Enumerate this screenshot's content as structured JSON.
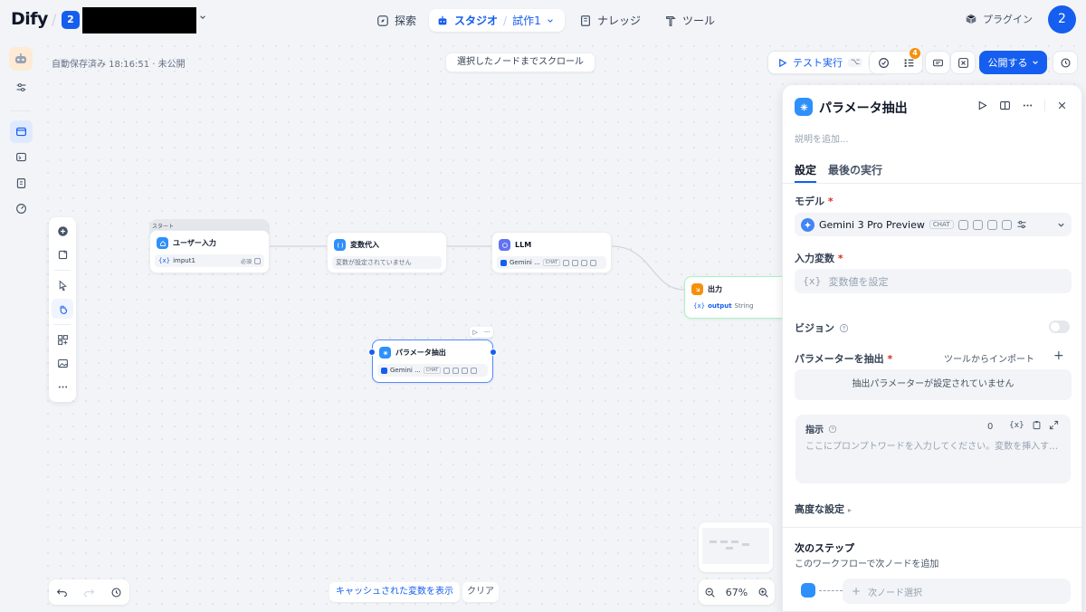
{
  "topbar": {
    "logo": "Dify",
    "workspace_badge": "2",
    "workspace_name": "",
    "nav": {
      "explore": "探索",
      "studio": "スタジオ",
      "studio_app": "試作1",
      "knowledge": "ナレッジ",
      "tools": "ツール"
    },
    "plugin": "プラグイン",
    "avatar": "2"
  },
  "canvas": {
    "autosave": "自動保存済み 18:16:51 · 未公開",
    "scroll_to_node": "選択したノードまでスクロール",
    "test_run": "テスト実行",
    "test_run_keys": [
      "⌥",
      "R"
    ],
    "checklist_badge": "4",
    "publish": "公開する",
    "zoom": "67%",
    "show_cache": "キャッシュされた変数を表示",
    "clear": "クリア"
  },
  "nodes": {
    "start_label": "スタート",
    "user_input": {
      "title": "ユーザー入力",
      "var_icon": "{x}",
      "var": "imput1",
      "required": "必須"
    },
    "assign": {
      "title": "変数代入",
      "empty": "変数が設定されていません"
    },
    "llm": {
      "title": "LLM",
      "model": "Gemini ...",
      "chip": "CHAT"
    },
    "output": {
      "title": "出力",
      "var_icon": "{x}",
      "var": "output",
      "type": "String"
    },
    "param": {
      "title": "パラメータ抽出",
      "model": "Gemini ...",
      "chip": "CHAT"
    }
  },
  "panel": {
    "title": "パラメータ抽出",
    "description_placeholder": "説明を追加...",
    "tabs": [
      "設定",
      "最後の実行"
    ],
    "model_label": "モデル",
    "model_name": "Gemini 3 Pro Preview",
    "model_chip": "CHAT",
    "input_label": "入力変数",
    "input_placeholder": "変数値を設定",
    "input_icon": "{x}",
    "vision_label": "ビジョン",
    "extract_label": "パラメーターを抽出",
    "import_tools": "ツールからインポート",
    "add": "+",
    "extract_empty": "抽出パラメーターが設定されていません",
    "instruction_label": "指示",
    "instruction_count": "0",
    "instruction_var": "{x}",
    "instruction_placeholder": "ここにプロンプトワードを入力してください。変数を挿入するには「{」を入力します。",
    "advanced": "高度な設定",
    "next_step_title": "次のステップ",
    "next_step_desc": "このワークフローで次ノードを追加",
    "next_node_select": "次ノード選択",
    "required_mark": "*"
  },
  "colors": {
    "accent": "#155eef",
    "canvas_bg": "#f2f4f7",
    "badge_orange": "#f79009",
    "node_blue": "#2e90fa",
    "node_orange": "#f79009",
    "node_purple": "#6172f3"
  }
}
